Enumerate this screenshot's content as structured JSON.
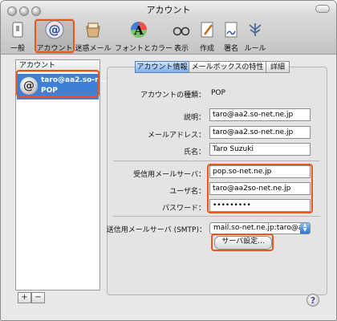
{
  "window": {
    "title": "アカウント"
  },
  "toolbar": {
    "items": [
      {
        "label": "一般"
      },
      {
        "label": "アカウント"
      },
      {
        "label": "迷惑メール"
      },
      {
        "label": "フォントとカラー"
      },
      {
        "label": "表示"
      },
      {
        "label": "作成"
      },
      {
        "label": "署名"
      },
      {
        "label": "ルール"
      }
    ]
  },
  "sidebar": {
    "header": "アカウント",
    "account": {
      "line1": "taro@aa2.so-n...",
      "line2": "POP"
    },
    "add_label": "+",
    "remove_label": "−"
  },
  "tabs": [
    {
      "label": "アカウント情報"
    },
    {
      "label": "メールボックスの特性"
    },
    {
      "label": "詳細"
    }
  ],
  "form": {
    "type_label": "アカウントの種類：",
    "type_value": "POP",
    "description_label": "説明：",
    "description_value": "taro@aa2.so-net.ne.jp",
    "email_label": "メールアドレス：",
    "email_value": "taro@aa2.so-net.ne.jp",
    "name_label": "氏名：",
    "name_value": "Taro Suzuki",
    "incoming_label": "受信用メールサーバ：",
    "incoming_value": "pop.so-net.ne.jp",
    "username_label": "ユーザ名：",
    "username_value": "taro@aa2so-net.ne.jp",
    "password_label": "パスワード：",
    "password_value": "•••••••••",
    "smtp_label": "送信用メールサーバ (SMTP)：",
    "smtp_value": "mail.so-net.ne.jp:taro@aa2",
    "server_settings_button": "サーバ設定..."
  },
  "help": {
    "symbol": "?"
  },
  "colors": {
    "highlight": "#e8551f",
    "selection": "#3d80d6"
  }
}
